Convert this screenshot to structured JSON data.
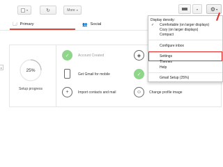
{
  "toolbar": {
    "select_caret": "▾",
    "refresh_icon": "↻",
    "more_label": "More",
    "more_caret": "▾",
    "view_caret": "▾",
    "gear_icon": "⚙",
    "gear_caret": "▾"
  },
  "tabs": [
    {
      "icon": "🗔",
      "label": "Primary"
    },
    {
      "icon": "👥",
      "label": "Social"
    }
  ],
  "setup": {
    "progress_value": "25%",
    "progress_fraction": 0.25,
    "progress_label": "Setup progress",
    "tasks": [
      {
        "label": "Account Created",
        "status": "done"
      },
      {
        "label": "Get Gmail for mobile",
        "status": "todo"
      },
      {
        "label": "Import contacts and mail",
        "status": "todo"
      },
      {
        "label": "Change profile image",
        "status": "todo"
      }
    ]
  },
  "settings_menu": {
    "section_title": "Display density:",
    "check_mark": "✓",
    "density_options": [
      "Comfortable (on larger displays)",
      "Cozy (on larger displays)",
      "Compact"
    ],
    "items": [
      "Configure inbox",
      "Settings",
      "Themes",
      "Help",
      "Gmail Setup (25%)"
    ]
  },
  "colors": {
    "accent_red": "#d14836",
    "done_green": "#8fd68a",
    "highlight_red": "#e03030"
  }
}
